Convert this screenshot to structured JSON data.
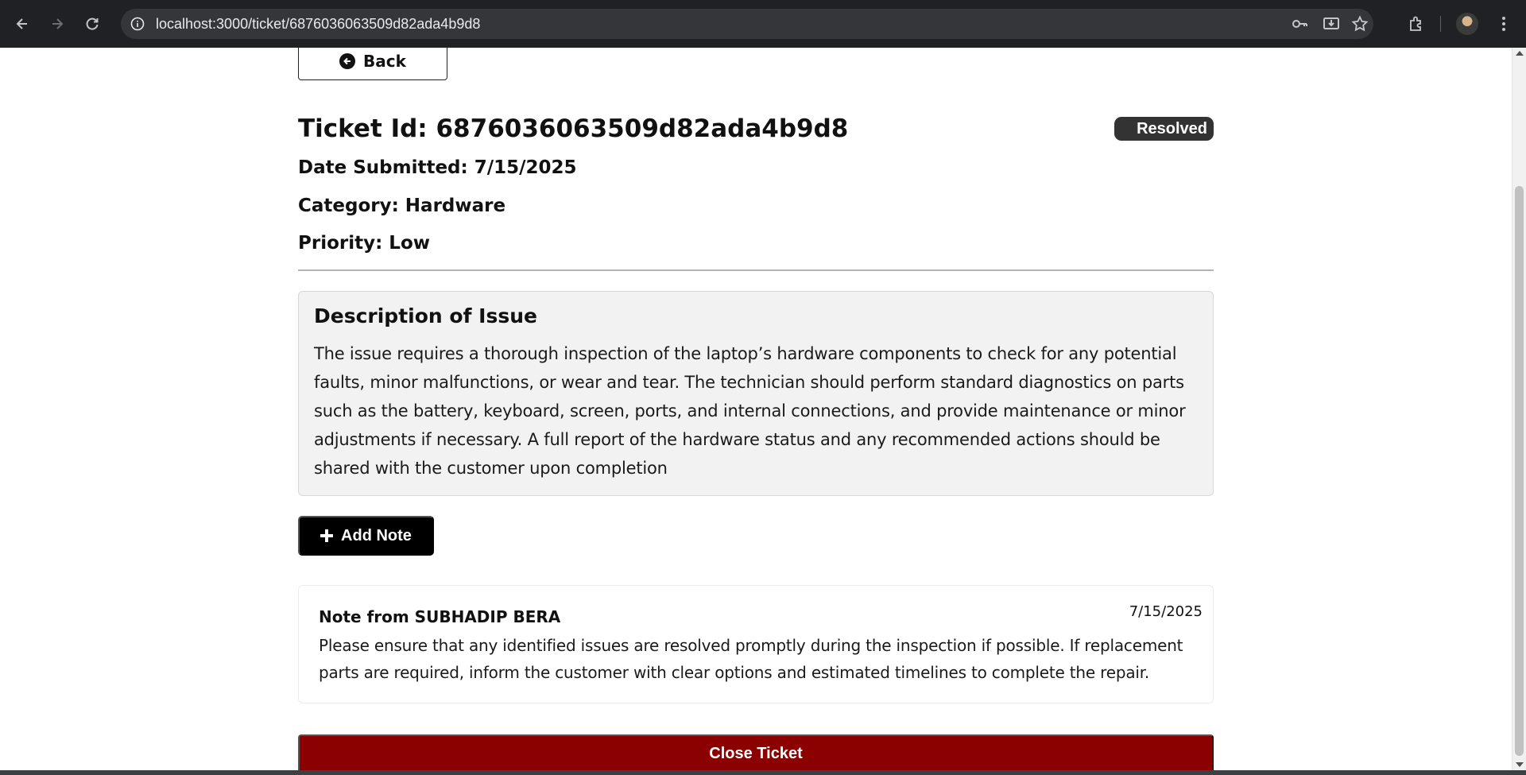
{
  "browser": {
    "url": "localhost:3000/ticket/6876036063509d82ada4b9d8"
  },
  "page": {
    "back_label": "Back",
    "ticket_title": "Ticket Id: 6876036063509d82ada4b9d8",
    "status": "Resolved",
    "date_submitted": "Date Submitted: 7/15/2025",
    "category": "Category: Hardware",
    "priority": "Priority: Low",
    "description_title": "Description of Issue",
    "description_text": "The issue requires a thorough inspection of the laptop’s hardware components to check for any potential faults, minor malfunctions, or wear and tear. The technician should perform standard diagnostics on parts such as the battery, keyboard, screen, ports, and internal connections, and provide maintenance or minor adjustments if necessary. A full report of the hardware status and any recommended actions should be shared with the customer upon completion",
    "add_note_label": "Add Note",
    "close_ticket_label": "Close Ticket"
  },
  "notes": [
    {
      "author": "Note from SUBHADIP BERA",
      "date": "7/15/2025",
      "text": "Please ensure that any identified issues are resolved promptly during the inspection if possible. If replacement parts are required, inform the customer with clear options and estimated timelines to complete the repair."
    }
  ],
  "colors": {
    "status_badge": "#333333",
    "close_button": "#8b0000",
    "add_note_button": "#000000",
    "description_bg": "#f2f2f2"
  }
}
